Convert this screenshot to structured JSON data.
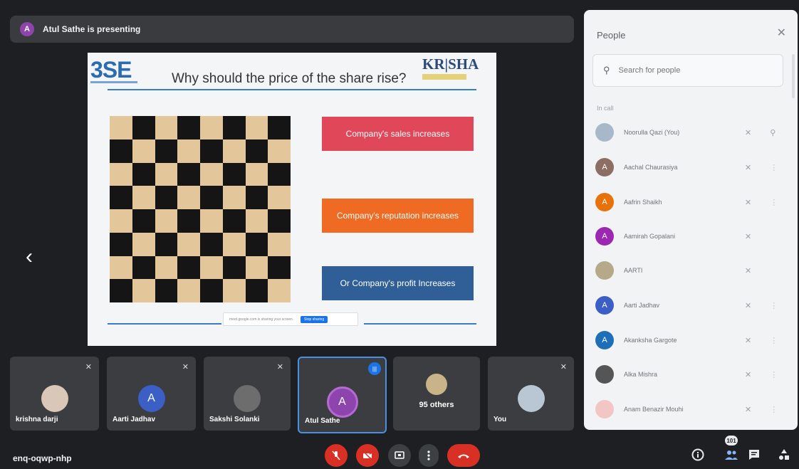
{
  "header": {
    "presenter_initial": "A",
    "presenting_text": "Atul Sathe is presenting"
  },
  "slide": {
    "logo_left": "3SE",
    "title": "Why should the price of the share rise?",
    "logo_right": "KR|SHA",
    "boxes": [
      "Company's sales increases",
      "Company's reputation increases",
      "Or Company's profit Increases"
    ],
    "share_bar_text": "meet.google.com is sharing your screen.",
    "share_bar_button": "Stop sharing",
    "colors": {
      "box1": "#e0485a",
      "box2": "#ef6a22",
      "box3": "#2f5f96"
    }
  },
  "nav": {
    "prev_icon": "‹",
    "next_icon": "›"
  },
  "tiles": [
    {
      "name": "krishna darji",
      "avatar": "",
      "color": "#d9c7b8"
    },
    {
      "name": "Aarti Jadhav",
      "avatar": "A",
      "color": "#3b5fc4"
    },
    {
      "name": "Sakshi Solanki",
      "avatar": "",
      "color": "#6d6d6d"
    },
    {
      "name": "Atul Sathe",
      "avatar": "A",
      "color": "#8e44ad"
    },
    {
      "name": "95 others",
      "avatar": "",
      "color": "#c9b48a"
    },
    {
      "name": "You",
      "avatar": "",
      "color": "#b8c7d3"
    }
  ],
  "bottom": {
    "meeting_code": "enq-oqwp-nhp",
    "participant_count": "101"
  },
  "people_panel": {
    "title": "People",
    "search_placeholder": "Search for people",
    "section_label": "In call",
    "people": [
      {
        "name": "Noorulla Qazi (You)",
        "initial": "",
        "color": "#a7b8c8"
      },
      {
        "name": "Aachal Chaurasiya",
        "initial": "A",
        "color": "#8d6e63"
      },
      {
        "name": "Aafrin Shaikh",
        "initial": "A",
        "color": "#e8710a"
      },
      {
        "name": "Aamirah Gopalani",
        "initial": "A",
        "color": "#9c27b0"
      },
      {
        "name": "AARTI",
        "initial": "",
        "color": "#b5a98a"
      },
      {
        "name": "Aarti Jadhav",
        "initial": "A",
        "color": "#3b5fc4"
      },
      {
        "name": "Akanksha Gargote",
        "initial": "A",
        "color": "#1e6fb8"
      },
      {
        "name": "Alka Mishra",
        "initial": "",
        "color": "#555555"
      },
      {
        "name": "Anam Benazir Mouhi",
        "initial": "",
        "color": "#f3c6c6"
      }
    ]
  }
}
